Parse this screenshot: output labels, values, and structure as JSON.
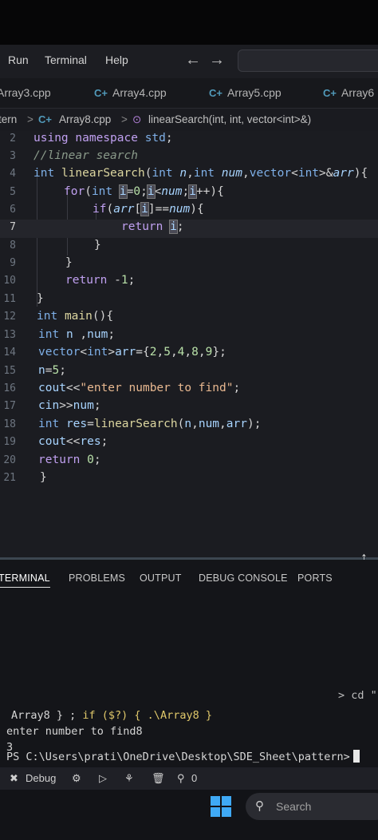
{
  "menu": {
    "items": [
      "Run",
      "Terminal",
      "Help"
    ]
  },
  "tabs": [
    {
      "label": "Array3.cpp"
    },
    {
      "label": "Array4.cpp"
    },
    {
      "label": "Array5.cpp"
    },
    {
      "label": "Array6"
    }
  ],
  "breadcrumb": {
    "folder": "tern",
    "file": "Array8.cpp",
    "symbol": "linearSearch(int, int, vector<int>&)"
  },
  "editor": {
    "line_numbers": [
      "2",
      "3",
      "4",
      "5",
      "6",
      "7",
      "8",
      "9",
      "10",
      "11",
      "12",
      "13",
      "14",
      "15",
      "16",
      "17",
      "18",
      "19",
      "20",
      "21"
    ],
    "active_line": "7",
    "lines": [
      "using namespace std;",
      "//linear search",
      "int linearSearch(int n,int num,vector<int>&arr){",
      "for(int i=0;i<num;i++){",
      "if(arr[i]==num){",
      "return i;",
      "}",
      "}",
      "return -1;",
      "}",
      "int main(){",
      "int n ,num;",
      "vector<int>arr={2,5,4,8,9};",
      "n=5;",
      "cout<<\"enter number to find\";",
      "cin>>num;",
      "int res=linearSearch(n,num,arr);",
      "cout<<res;",
      "return 0;",
      "}"
    ]
  },
  "panel": {
    "tabs": [
      "TERMINAL",
      "PROBLEMS",
      "OUTPUT",
      "DEBUG CONSOLE",
      "PORTS"
    ],
    "active_tab": "TERMINAL"
  },
  "terminal": {
    "cd_hint": "> cd \"",
    "cmd_part1": "Array8 } ; ",
    "cmd_part2": "if ($?) { .\\Array8 }",
    "output_line1": "enter number to find8",
    "output_line2": "3",
    "prompt": "PS C:\\Users\\prati\\OneDrive\\Desktop\\SDE_Sheet\\pattern>"
  },
  "statusbar": {
    "debug_label": "Debug",
    "ports_count": "0"
  },
  "taskbar": {
    "search_label": "Search"
  },
  "colors": {
    "keyword": "#c0a0f0",
    "type": "#7fb0e8",
    "function": "#dcd6a0",
    "number": "#b8e0a8",
    "string": "#e8b890",
    "windows_logo": "#3fa9f5"
  }
}
